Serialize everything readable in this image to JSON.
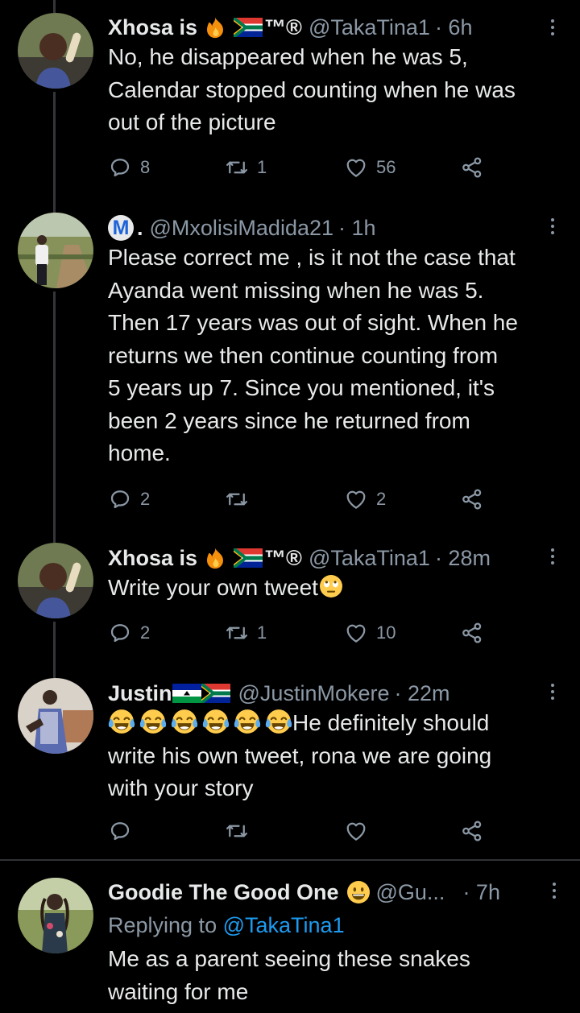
{
  "tweets": [
    {
      "name": "Xhosa is",
      "suffix": "™®",
      "handle": "@TakaTina1",
      "time": "· 6h",
      "text": [
        "No, he disappeared when he was 5,",
        "Calendar stopped counting when he was",
        "out of the picture"
      ],
      "replies": "8",
      "retweets": "1",
      "likes": "56"
    },
    {
      "badge": "M",
      "name": ".",
      "handle": "@MxolisiMadida21",
      "time": "· 1h",
      "text": [
        "Please correct me , is it not the case that",
        "Ayanda went missing when he was 5.",
        "Then 17 years was out of sight. When he",
        "returns we then continue counting from",
        "5 years up 7. Since you mentioned, it's",
        "been 2 years since he returned from",
        "home."
      ],
      "replies": "2",
      "retweets": "",
      "likes": "2"
    },
    {
      "name": "Xhosa is",
      "suffix": "™®",
      "handle": "@TakaTina1",
      "time": "· 28m",
      "text": [
        "Write your own tweet"
      ],
      "replies": "2",
      "retweets": "1",
      "likes": "10"
    },
    {
      "name": "Justin",
      "handle": "@JustinMokere",
      "time": "· 22m",
      "text": [
        "He definitely should",
        "write his own tweet, rona we are going",
        "with your story"
      ],
      "replies": "",
      "retweets": "",
      "likes": ""
    },
    {
      "name": "Goodie The Good One",
      "handle": "@Gu...",
      "time": "· 7h",
      "reply_prefix": "Replying to",
      "reply_handle": "@TakaTina1",
      "text": [
        "Me as a parent seeing these snakes",
        "waiting for me"
      ]
    }
  ],
  "colors": {
    "background": "#000000",
    "text": "#e7e9ea",
    "muted": "#8b98a5",
    "link": "#1d9bf0",
    "divider": "#2f3336"
  },
  "icons": [
    "reply-icon",
    "retweet-icon",
    "like-icon",
    "share-icon",
    "more-icon",
    "fire-emoji",
    "south-africa-flag",
    "lesotho-flag",
    "tears-of-joy-emoji",
    "rolling-eyes-emoji",
    "grinning-emoji"
  ]
}
